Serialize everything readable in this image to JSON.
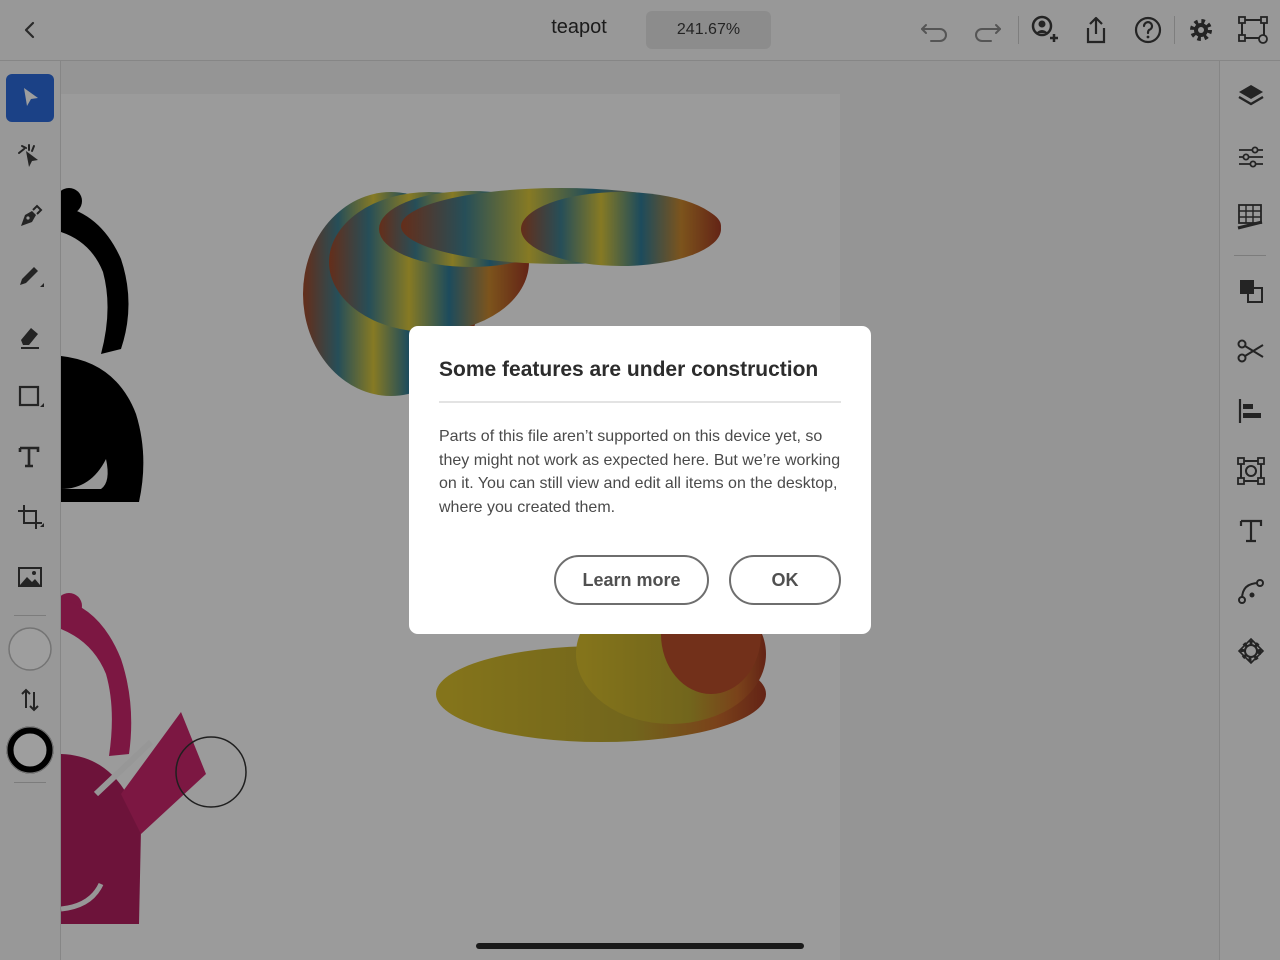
{
  "header": {
    "doc_title": "teapot",
    "zoom_level": "241.67%"
  },
  "dialog": {
    "title": "Some features are under construction",
    "body": "Parts of this file aren’t supported on this device yet, so they might not work as expected here. But we’re working on it. You can still view and edit all items on the desktop, where you created them.",
    "learn_more_label": "Learn more",
    "ok_label": "OK"
  },
  "colors": {
    "accent": "#2d6ad8",
    "overlay": "rgba(0,0,0,0.38)",
    "teapot_black": "#000000",
    "teapot_magenta": "#c8266b"
  },
  "toolbar_icons": {
    "left": [
      "select-icon",
      "direct-select-icon",
      "pen-icon",
      "pencil-icon",
      "eraser-icon",
      "rectangle-icon",
      "text-icon",
      "crop-icon",
      "image-icon",
      "fill-swatch-icon",
      "swap-icon",
      "stroke-swatch-icon"
    ],
    "top": [
      "back-icon",
      "undo-icon",
      "redo-icon",
      "invite-icon",
      "share-icon",
      "help-icon",
      "settings-icon",
      "artboard-view-icon"
    ],
    "right": [
      "layers-icon",
      "properties-icon",
      "grid-icon",
      "arrange-icon",
      "scissors-icon",
      "align-icon",
      "transform-icon",
      "type-icon",
      "path-icon",
      "symbol-icon"
    ]
  }
}
